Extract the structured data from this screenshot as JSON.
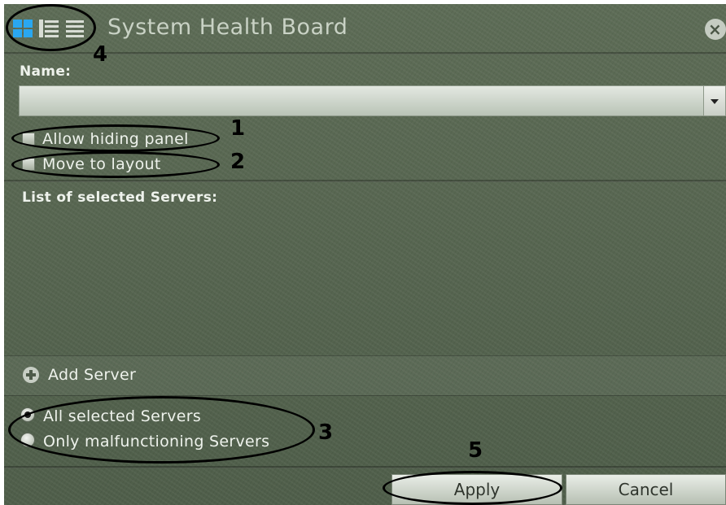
{
  "window": {
    "title": "System Health Board",
    "close_glyph": "×",
    "view_icons": [
      "tiles-view-icon",
      "list-view-icon",
      "details-view-icon"
    ]
  },
  "form": {
    "name_label": "Name:",
    "name_value": "",
    "allow_hiding_panel_label": "Allow hiding panel",
    "allow_hiding_panel_checked": false,
    "move_to_layout_label": "Move to layout",
    "move_to_layout_checked": false,
    "servers_list_label": "List of selected Servers:",
    "servers": [],
    "add_server_label": "Add Server",
    "mode_options": [
      {
        "label": "All selected Servers",
        "selected": true
      },
      {
        "label": "Only malfunctioning Servers",
        "selected": false
      }
    ]
  },
  "buttons": {
    "apply_label": "Apply",
    "cancel_label": "Cancel"
  },
  "annotations": {
    "n1": "1",
    "n2": "2",
    "n3": "3",
    "n4": "4",
    "n5": "5"
  },
  "colors": {
    "panel_bg": "#55654f",
    "active_icon": "#2aa7f0",
    "text": "#eef2ec"
  }
}
